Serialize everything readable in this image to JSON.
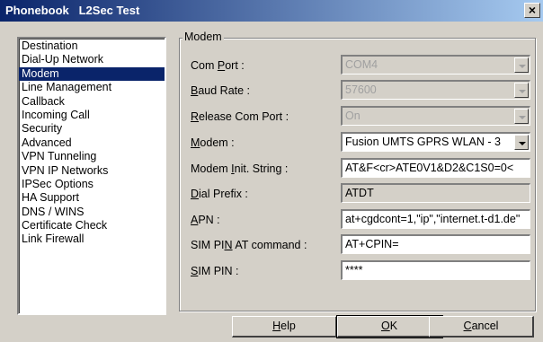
{
  "window": {
    "title": "Phonebook   L2Sec Test",
    "close_glyph": "×"
  },
  "nav": {
    "items": [
      "Destination",
      "Dial-Up Network",
      "Modem",
      "Line Management",
      "Callback",
      "Incoming Call",
      "Security",
      "Advanced",
      "VPN Tunneling",
      "VPN IP Networks",
      "IPSec Options",
      "HA Support",
      "DNS / WINS",
      "Certificate Check",
      "Link Firewall"
    ],
    "selected": "Modem"
  },
  "modem": {
    "group_title": "Modem",
    "com_port": {
      "label_pre": "Com ",
      "label_u": "P",
      "label_post": "ort :",
      "value": "COM4"
    },
    "baud_rate": {
      "label_pre": "",
      "label_u": "B",
      "label_post": "aud Rate :",
      "value": "57600"
    },
    "release_com_port": {
      "label_pre": "",
      "label_u": "R",
      "label_post": "elease Com Port :",
      "value": "On"
    },
    "modem": {
      "label_pre": "",
      "label_u": "M",
      "label_post": "odem :",
      "value": "Fusion UMTS GPRS WLAN - 3"
    },
    "init_string": {
      "label_pre": "Modem ",
      "label_u": "I",
      "label_post": "nit. String :",
      "value": "AT&F<cr>ATE0V1&D2&C1S0=0<"
    },
    "dial_prefix": {
      "label_pre": "",
      "label_u": "D",
      "label_post": "ial Prefix :",
      "value": "ATDT"
    },
    "apn": {
      "label_pre": "",
      "label_u": "A",
      "label_post": "PN :",
      "value": "at+cgdcont=1,\"ip\",\"internet.t-d1.de\""
    },
    "sim_pin_cmd": {
      "label_pre": "SIM PI",
      "label_u": "N",
      "label_post": " AT command :",
      "value": "AT+CPIN="
    },
    "sim_pin": {
      "label_pre": "",
      "label_u": "S",
      "label_post": "IM PIN :",
      "value": "****"
    }
  },
  "buttons": {
    "help": {
      "u": "H",
      "rest": "elp"
    },
    "ok": {
      "u": "O",
      "rest": "K"
    },
    "cancel": {
      "u": "C",
      "rest": "ancel"
    }
  }
}
